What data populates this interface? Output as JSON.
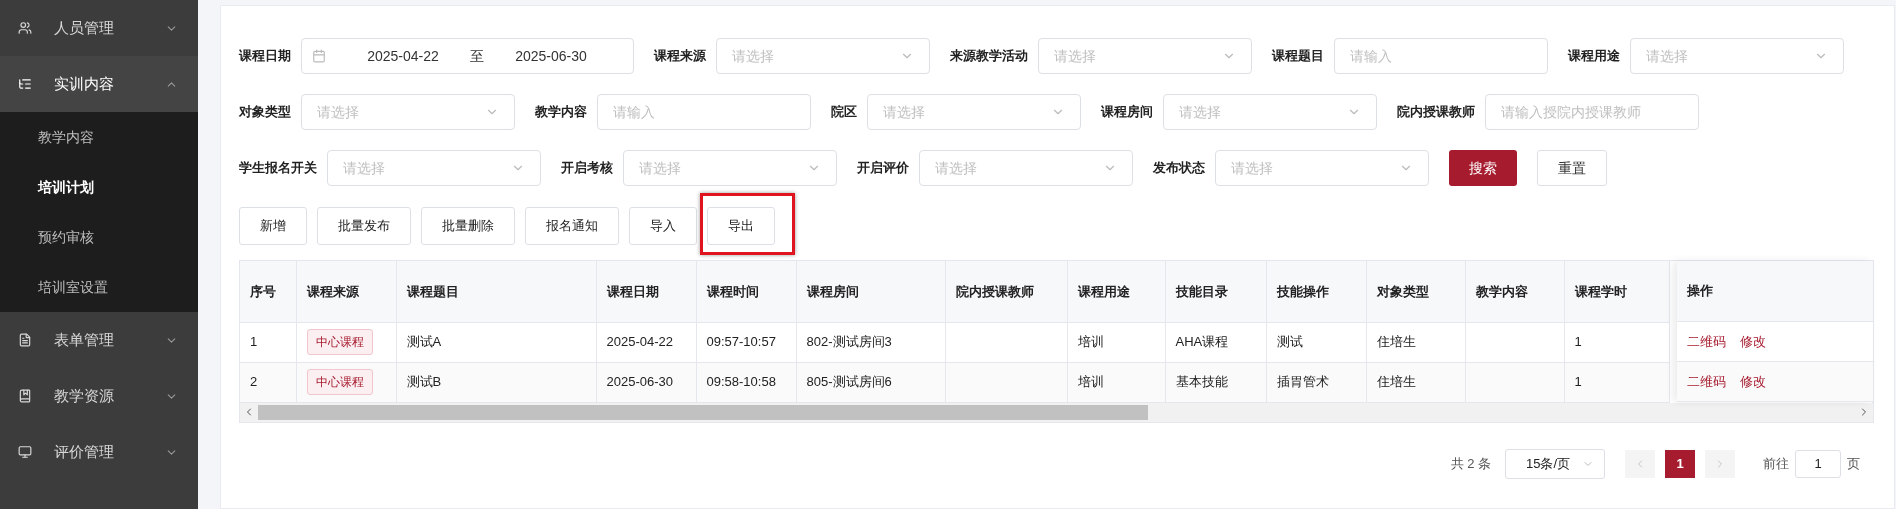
{
  "sidebar": {
    "items": [
      {
        "label": "人员管理",
        "expanded": false
      },
      {
        "label": "实训内容",
        "expanded": true,
        "children": [
          {
            "label": "教学内容",
            "selected": false
          },
          {
            "label": "培训计划",
            "selected": true
          },
          {
            "label": "预约审核",
            "selected": false
          },
          {
            "label": "培训室设置",
            "selected": false
          }
        ]
      },
      {
        "label": "表单管理",
        "expanded": false
      },
      {
        "label": "教学资源",
        "expanded": false
      },
      {
        "label": "评价管理",
        "expanded": false
      }
    ]
  },
  "filters": [
    [
      {
        "kind": "date_range",
        "label": "课程日期",
        "start": "2025-04-22",
        "separator": "至",
        "end": "2025-06-30"
      },
      {
        "kind": "select",
        "label": "课程来源",
        "placeholder": "请选择"
      },
      {
        "kind": "select",
        "label": "来源教学活动",
        "placeholder": "请选择"
      },
      {
        "kind": "input",
        "label": "课程题目",
        "placeholder": "请输入"
      },
      {
        "kind": "select",
        "label": "课程用途",
        "placeholder": "请选择"
      }
    ],
    [
      {
        "kind": "select",
        "label": "对象类型",
        "placeholder": "请选择"
      },
      {
        "kind": "input",
        "label": "教学内容",
        "placeholder": "请输入"
      },
      {
        "kind": "select",
        "label": "院区",
        "placeholder": "请选择"
      },
      {
        "kind": "select",
        "label": "课程房间",
        "placeholder": "请选择"
      },
      {
        "kind": "input",
        "label": "院内授课教师",
        "placeholder": "请输入授院内授课教师"
      }
    ],
    [
      {
        "kind": "select",
        "label": "学生报名开关",
        "placeholder": "请选择"
      },
      {
        "kind": "select",
        "label": "开启考核",
        "placeholder": "请选择"
      },
      {
        "kind": "select",
        "label": "开启评价",
        "placeholder": "请选择"
      },
      {
        "kind": "select",
        "label": "发布状态",
        "placeholder": "请选择"
      },
      {
        "kind": "primary_button",
        "label": "搜索"
      },
      {
        "kind": "button",
        "label": "重置"
      }
    ]
  ],
  "actions": [
    {
      "label": "新增",
      "highlighted": false
    },
    {
      "label": "批量发布",
      "highlighted": false
    },
    {
      "label": "批量删除",
      "highlighted": false
    },
    {
      "label": "报名通知",
      "highlighted": false
    },
    {
      "label": "导入",
      "highlighted": false
    },
    {
      "label": "导出",
      "highlighted": true
    }
  ],
  "table": {
    "columns": [
      "序号",
      "课程来源",
      "课程题目",
      "课程日期",
      "课程时间",
      "课程房间",
      "院内授课教师",
      "课程用途",
      "技能目录",
      "技能操作",
      "对象类型",
      "教学内容",
      "课程学时"
    ],
    "action_column": "操作",
    "rows": [
      {
        "cells": [
          "1",
          "中心课程",
          "测试A",
          "2025-04-22",
          "09:57-10:57",
          "802-测试房间3",
          "",
          "培训",
          "AHA课程",
          "测试",
          "住培生",
          "",
          "1"
        ],
        "actions": [
          "二维码",
          "修改"
        ]
      },
      {
        "cells": [
          "2",
          "中心课程",
          "测试B",
          "2025-06-30",
          "09:58-10:58",
          "805-测试房间6",
          "",
          "培训",
          "基本技能",
          "插胃管术",
          "住培生",
          "",
          "1"
        ],
        "actions": [
          "二维码",
          "修改"
        ]
      }
    ]
  },
  "pagination": {
    "total": "共 2 条",
    "page_size": "15条/页",
    "pages": [
      {
        "label": "1",
        "selected": true
      }
    ],
    "goto_label": "前往",
    "goto_value": "1",
    "goto_suffix": "页"
  }
}
